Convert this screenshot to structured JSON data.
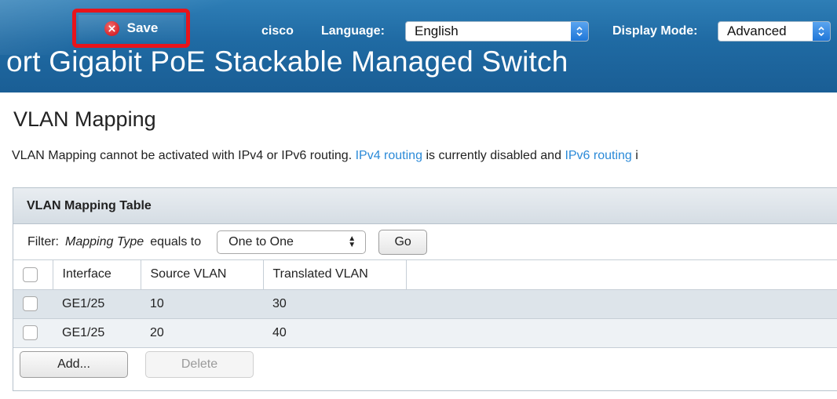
{
  "header": {
    "save_label": "Save",
    "cisco_label": "cisco",
    "language_label": "Language:",
    "language_value": "English",
    "display_mode_label": "Display Mode:",
    "display_mode_value": "Advanced",
    "banner_title": "ort Gigabit PoE Stackable Managed Switch"
  },
  "page": {
    "title": "VLAN Mapping",
    "notice_prefix": "VLAN Mapping cannot be activated with IPv4 or IPv6 routing.",
    "ipv4_link": "IPv4 routing",
    "notice_middle": "is currently disabled and",
    "ipv6_link": "IPv6 routing",
    "notice_suffix": "i"
  },
  "table": {
    "title": "VLAN Mapping Table",
    "filter_label": "Filter:",
    "filter_field": "Mapping Type",
    "filter_op": "equals to",
    "filter_value": "One to One",
    "go_label": "Go",
    "columns": [
      "Interface",
      "Source VLAN",
      "Translated VLAN"
    ],
    "rows": [
      {
        "interface": "GE1/25",
        "source_vlan": "10",
        "translated_vlan": "30"
      },
      {
        "interface": "GE1/25",
        "source_vlan": "20",
        "translated_vlan": "40"
      }
    ],
    "add_label": "Add...",
    "delete_label": "Delete"
  },
  "colors": {
    "banner": "#1f6aa3",
    "highlight": "#e8141b",
    "link": "#2b8ad8"
  }
}
